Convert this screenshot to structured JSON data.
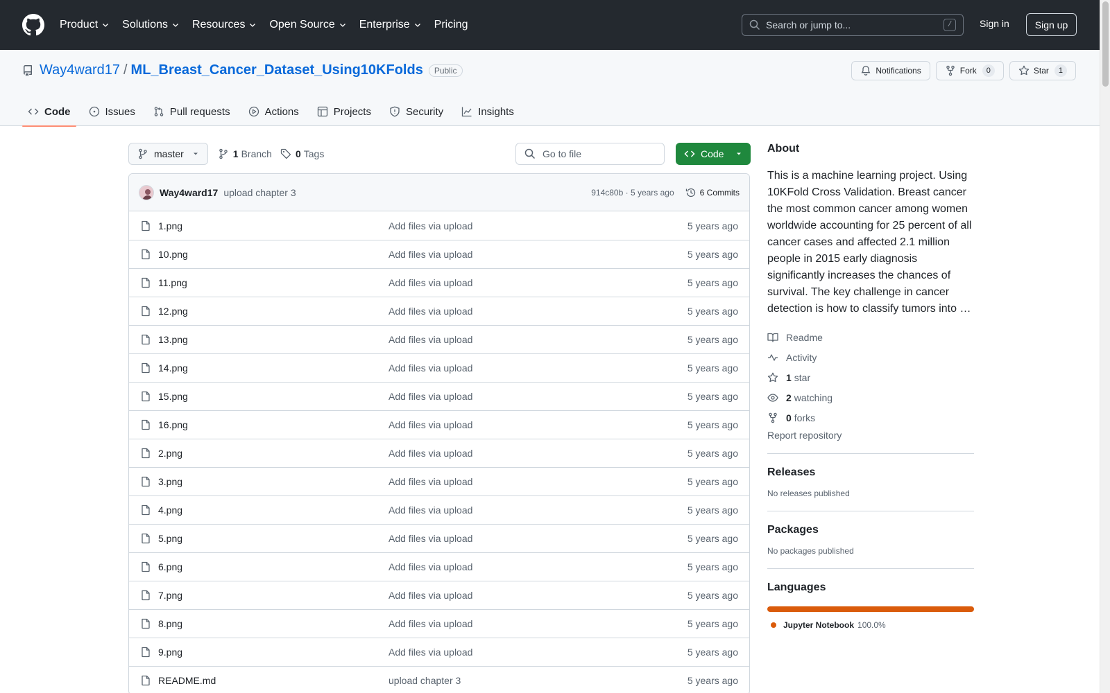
{
  "header": {
    "nav": [
      {
        "label": "Product",
        "dropdown": true
      },
      {
        "label": "Solutions",
        "dropdown": true
      },
      {
        "label": "Resources",
        "dropdown": true
      },
      {
        "label": "Open Source",
        "dropdown": true
      },
      {
        "label": "Enterprise",
        "dropdown": true
      },
      {
        "label": "Pricing",
        "dropdown": false
      }
    ],
    "search_placeholder": "Search or jump to...",
    "search_shortcut": "/",
    "sign_in": "Sign in",
    "sign_up": "Sign up"
  },
  "repo": {
    "owner": "Way4ward17",
    "separator": "/",
    "name": "ML_Breast_Cancer_Dataset_Using10KFolds",
    "visibility": "Public",
    "actions": {
      "notifications": "Notifications",
      "fork": "Fork",
      "fork_count": "0",
      "star": "Star",
      "star_count": "1"
    },
    "tabs": [
      {
        "label": "Code",
        "icon": "code-icon",
        "active": true
      },
      {
        "label": "Issues",
        "icon": "issue-icon",
        "active": false
      },
      {
        "label": "Pull requests",
        "icon": "pull-request-icon",
        "active": false
      },
      {
        "label": "Actions",
        "icon": "play-icon",
        "active": false
      },
      {
        "label": "Projects",
        "icon": "table-icon",
        "active": false
      },
      {
        "label": "Security",
        "icon": "shield-icon",
        "active": false
      },
      {
        "label": "Insights",
        "icon": "graph-icon",
        "active": false
      }
    ]
  },
  "toolbar": {
    "branch": "master",
    "branch_count": "1",
    "branch_label": "Branch",
    "tag_count": "0",
    "tag_label": "Tags",
    "goto_placeholder": "Go to file",
    "code_button": "Code"
  },
  "latest_commit": {
    "author": "Way4ward17",
    "message": "upload chapter 3",
    "hash_time": "914c80b · 5 years ago",
    "commits": "6 Commits"
  },
  "files": [
    {
      "name": "1.png",
      "commit": "Add files via upload",
      "age": "5 years ago"
    },
    {
      "name": "10.png",
      "commit": "Add files via upload",
      "age": "5 years ago"
    },
    {
      "name": "11.png",
      "commit": "Add files via upload",
      "age": "5 years ago"
    },
    {
      "name": "12.png",
      "commit": "Add files via upload",
      "age": "5 years ago"
    },
    {
      "name": "13.png",
      "commit": "Add files via upload",
      "age": "5 years ago"
    },
    {
      "name": "14.png",
      "commit": "Add files via upload",
      "age": "5 years ago"
    },
    {
      "name": "15.png",
      "commit": "Add files via upload",
      "age": "5 years ago"
    },
    {
      "name": "16.png",
      "commit": "Add files via upload",
      "age": "5 years ago"
    },
    {
      "name": "2.png",
      "commit": "Add files via upload",
      "age": "5 years ago"
    },
    {
      "name": "3.png",
      "commit": "Add files via upload",
      "age": "5 years ago"
    },
    {
      "name": "4.png",
      "commit": "Add files via upload",
      "age": "5 years ago"
    },
    {
      "name": "5.png",
      "commit": "Add files via upload",
      "age": "5 years ago"
    },
    {
      "name": "6.png",
      "commit": "Add files via upload",
      "age": "5 years ago"
    },
    {
      "name": "7.png",
      "commit": "Add files via upload",
      "age": "5 years ago"
    },
    {
      "name": "8.png",
      "commit": "Add files via upload",
      "age": "5 years ago"
    },
    {
      "name": "9.png",
      "commit": "Add files via upload",
      "age": "5 years ago"
    },
    {
      "name": "README.md",
      "commit": "upload chapter 3",
      "age": "5 years ago"
    }
  ],
  "sidebar": {
    "about_heading": "About",
    "about_text": "This is a machine learning project. Using 10KFold Cross Validation. Breast cancer the most common cancer among women worldwide accounting for 25 percent of all cancer cases and affected 2.1 million people in 2015 early diagnosis significantly increases the chances of survival. The key challenge in cancer detection is how to classify tumors into …",
    "readme": "Readme",
    "activity": "Activity",
    "stars_count": "1",
    "stars_label": "star",
    "watching_count": "2",
    "watching_label": "watching",
    "forks_count": "0",
    "forks_label": "forks",
    "report": "Report repository",
    "releases_heading": "Releases",
    "releases_sub": "No releases published",
    "packages_heading": "Packages",
    "packages_sub": "No packages published",
    "languages_heading": "Languages",
    "language_name": "Jupyter Notebook",
    "language_pct": "100.0%",
    "language_color": "#DA5B0B"
  }
}
